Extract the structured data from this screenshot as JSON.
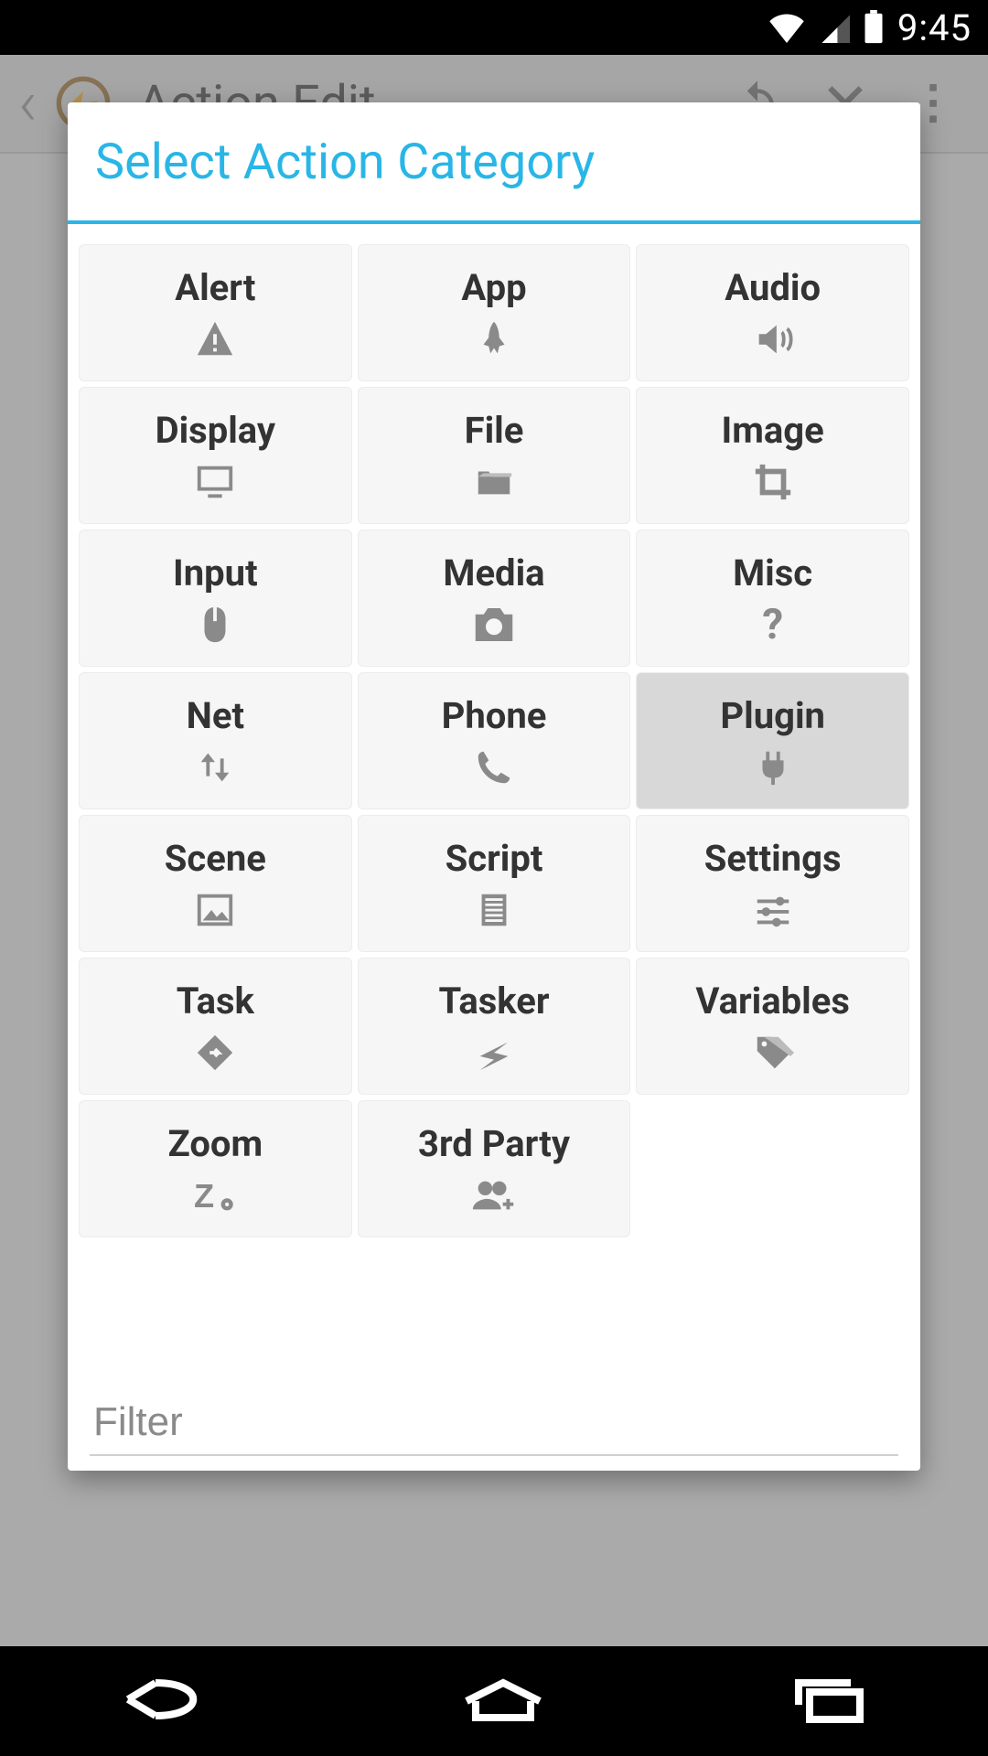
{
  "statusbar": {
    "time": "9:45"
  },
  "appbar": {
    "title": "Action Edit"
  },
  "dialog": {
    "title": "Select Action Category",
    "filter_placeholder": "Filter",
    "selected": "Plugin",
    "categories": [
      {
        "label": "Alert",
        "icon": "alert-icon"
      },
      {
        "label": "App",
        "icon": "rocket-icon"
      },
      {
        "label": "Audio",
        "icon": "speaker-icon"
      },
      {
        "label": "Display",
        "icon": "monitor-icon"
      },
      {
        "label": "File",
        "icon": "folder-icon"
      },
      {
        "label": "Image",
        "icon": "crop-icon"
      },
      {
        "label": "Input",
        "icon": "mouse-icon"
      },
      {
        "label": "Media",
        "icon": "camera-icon"
      },
      {
        "label": "Misc",
        "icon": "question-icon"
      },
      {
        "label": "Net",
        "icon": "updown-icon"
      },
      {
        "label": "Phone",
        "icon": "phone-icon"
      },
      {
        "label": "Plugin",
        "icon": "plug-icon"
      },
      {
        "label": "Scene",
        "icon": "picture-icon"
      },
      {
        "label": "Script",
        "icon": "script-icon"
      },
      {
        "label": "Settings",
        "icon": "sliders-icon"
      },
      {
        "label": "Task",
        "icon": "directions-icon"
      },
      {
        "label": "Tasker",
        "icon": "bolt-icon"
      },
      {
        "label": "Variables",
        "icon": "tags-icon"
      },
      {
        "label": "Zoom",
        "icon": "zoom-icon"
      },
      {
        "label": "3rd Party",
        "icon": "group-add-icon"
      }
    ]
  }
}
